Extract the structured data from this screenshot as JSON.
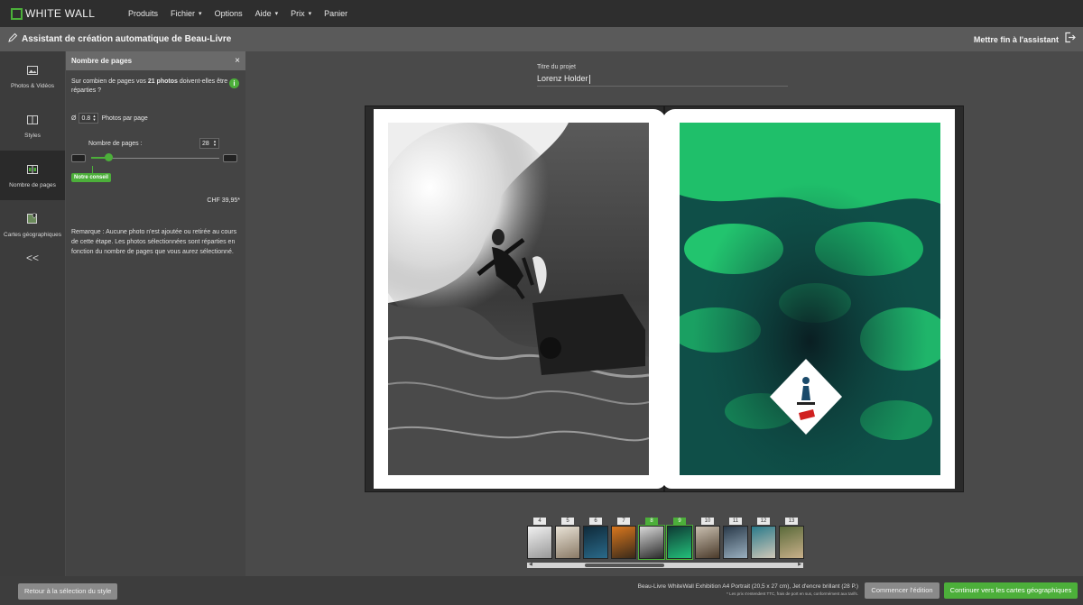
{
  "app": {
    "logo_text": "WHITE WALL",
    "accent": "#4caf3a"
  },
  "nav": [
    {
      "label": "Produits",
      "has_menu": false
    },
    {
      "label": "Fichier",
      "has_menu": true
    },
    {
      "label": "Options",
      "has_menu": false
    },
    {
      "label": "Aide",
      "has_menu": true
    },
    {
      "label": "Prix",
      "has_menu": true
    },
    {
      "label": "Panier",
      "has_menu": false
    }
  ],
  "wizard": {
    "title": "Assistant de création automatique de Beau-Livre",
    "end_label": "Mettre fin à l'assistant"
  },
  "rail": {
    "items": [
      {
        "label": "Photos & Vidéos",
        "icon": "image-icon"
      },
      {
        "label": "Styles",
        "icon": "book-icon"
      },
      {
        "label": "Nombre de pages",
        "icon": "pages-icon",
        "active": true
      },
      {
        "label": "Cartes géographiques",
        "icon": "map-pin-icon"
      }
    ],
    "collapse": "<<"
  },
  "panel": {
    "title": "Nombre de pages",
    "close": "×",
    "question_prefix": "Sur combien de pages vos ",
    "question_bold": "21 photos",
    "question_suffix": " doivent-elles être réparties ?",
    "info": "i",
    "avg_symbol": "Ø",
    "photos_per_page": "0.8",
    "photos_per_page_label": "Photos par page",
    "pages_label": "Nombre de pages :",
    "pages_value": "28",
    "slider_level": 0.14,
    "advice_badge": "Notre conseil",
    "price": "CHF 39,95*",
    "note": "Remarque : Aucune photo n'est ajoutée ou retirée au cours de cette étape. Les photos sélectionnées sont réparties en fonction du nombre de pages que vous aurez sélectionné."
  },
  "project": {
    "title_label": "Titre du projet",
    "title_value": "Lorenz Holder"
  },
  "filmstrip": [
    {
      "num": "4",
      "selected": false,
      "c1": "#f0f0f0",
      "c2": "#999999"
    },
    {
      "num": "5",
      "selected": false,
      "c1": "#e8e2d6",
      "c2": "#8a7a66"
    },
    {
      "num": "6",
      "selected": false,
      "c1": "#0f2a3a",
      "c2": "#2a6a8a"
    },
    {
      "num": "7",
      "selected": false,
      "c1": "#d9771e",
      "c2": "#3a2a1a"
    },
    {
      "num": "8",
      "selected": true,
      "c1": "#d8d8d8",
      "c2": "#2a2a2a"
    },
    {
      "num": "9",
      "selected": true,
      "c1": "#0e3a34",
      "c2": "#23c07a"
    },
    {
      "num": "10",
      "selected": false,
      "c1": "#c9bfb0",
      "c2": "#4a3a2a"
    },
    {
      "num": "11",
      "selected": false,
      "c1": "#2a3a4a",
      "c2": "#9ab0c0"
    },
    {
      "num": "12",
      "selected": false,
      "c1": "#2a7a8a",
      "c2": "#d0c8b8"
    },
    {
      "num": "13",
      "selected": false,
      "c1": "#5a6a3a",
      "c2": "#c9b08a"
    }
  ],
  "footer": {
    "back_label": "Retour à la sélection du style",
    "product_line": "Beau-Livre WhiteWall Exhibition A4 Portrait (20,5 x 27 cm), Jet d'encre brillant (28 P.)",
    "product_small": "* Les prix s'entendent TTC, frais de port en sus, conformément aux tarifs.",
    "edit_label": "Commencer l'édition",
    "next_label": "Continuer vers les cartes géographiques"
  }
}
